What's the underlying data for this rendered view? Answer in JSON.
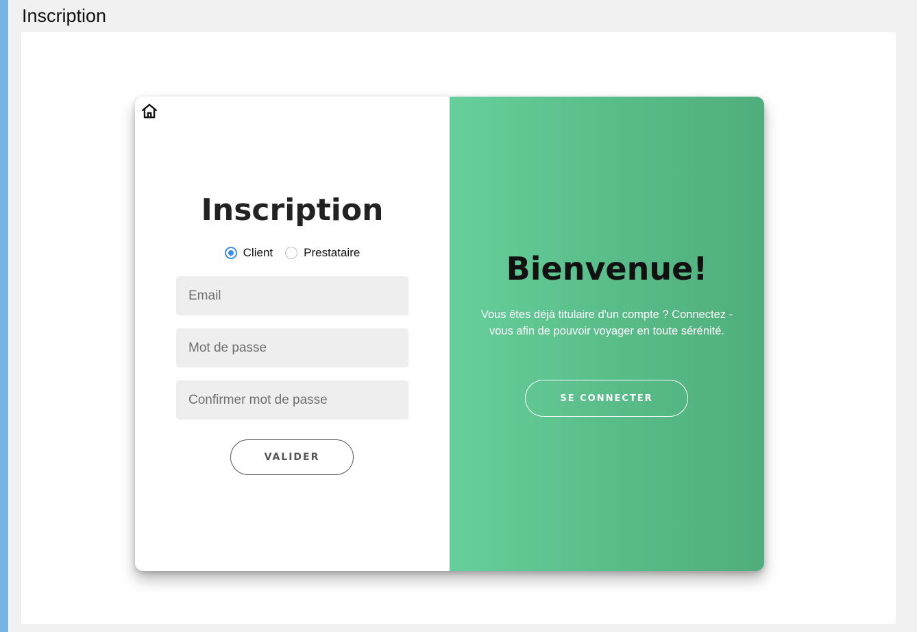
{
  "page": {
    "heading": "Inscription"
  },
  "form": {
    "title": "Inscription",
    "roles": [
      {
        "label": "Client",
        "checked": true
      },
      {
        "label": "Prestataire",
        "checked": false
      }
    ],
    "email_placeholder": "Email",
    "password_placeholder": "Mot de passe",
    "confirm_placeholder": "Confirmer mot de passe",
    "submit_label": "VALIDER"
  },
  "welcome": {
    "title": "Bienvenue!",
    "text": "Vous êtes déjà titulaire d'un compte ? Connectez - vous afin de pouvoir voyager en toute sérénité.",
    "button_label": "SE CONNECTER"
  },
  "colors": {
    "accent_bar": "#77b3e2",
    "panel_green_start": "#66cf9b",
    "panel_green_end": "#4fae7c",
    "radio_blue": "#3b8cf0"
  },
  "icons": {
    "home": "home-icon"
  }
}
